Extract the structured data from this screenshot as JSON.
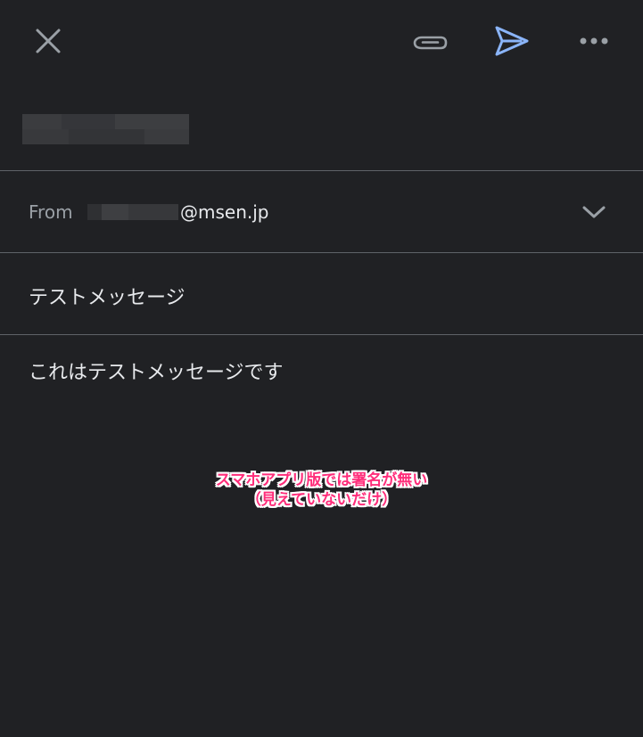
{
  "toolbar": {
    "close_icon": "close-icon",
    "attach_icon": "paperclip-icon",
    "send_icon": "send-icon",
    "more_icon": "more-horizontal-icon",
    "send_color": "#8ab4f8"
  },
  "from": {
    "label": "From",
    "address_suffix": "@msen.jp",
    "dropdown_icon": "chevron-down-icon"
  },
  "subject": "テストメッセージ",
  "body": "これはテストメッセージです",
  "annotation": {
    "line1": "スマホアプリ版では署名が無い",
    "line2": "（見えていないだけ）",
    "color": "#ff2d7a"
  }
}
